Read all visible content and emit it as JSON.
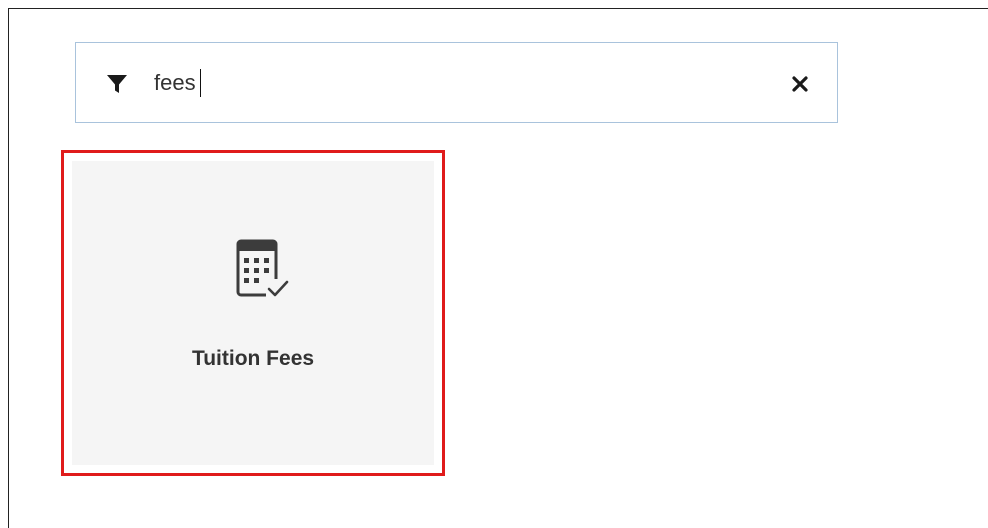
{
  "filter": {
    "value": "fees",
    "icon": "filter-icon",
    "clear_icon": "close-icon"
  },
  "results": [
    {
      "label": "Tuition Fees",
      "icon": "calculator-check-icon"
    }
  ],
  "colors": {
    "highlight_border": "#e01b1b",
    "input_border": "#a9c3dc",
    "tile_background": "#f5f5f5",
    "text": "#333333"
  }
}
